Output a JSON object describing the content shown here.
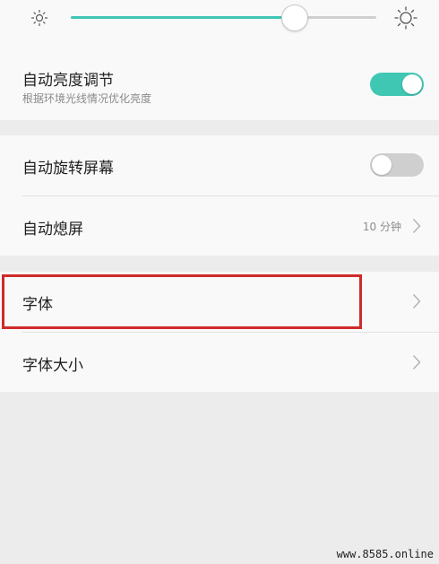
{
  "brightness": {
    "level": 0.73,
    "low_icon": "sun-small-icon",
    "high_icon": "sun-large-icon"
  },
  "display_settings": {
    "auto_brightness": {
      "label": "自动亮度调节",
      "description": "根据环境光线情况优化亮度",
      "enabled": true
    },
    "auto_rotate": {
      "label": "自动旋转屏幕",
      "enabled": false
    },
    "auto_screen_off": {
      "label": "自动熄屏",
      "value": "10 分钟",
      "icon": "chevron-right-icon"
    },
    "font": {
      "label": "字体",
      "icon": "chevron-right-icon"
    },
    "font_size": {
      "label": "字体大小",
      "icon": "chevron-right-icon"
    }
  },
  "watermark": "www.8585.online",
  "colors": {
    "accent": "#3fc7b4",
    "toggle_off": "#cfcfcf",
    "highlight": "#cf2a2a",
    "background": "#ececec",
    "card": "#f9f9f9"
  }
}
